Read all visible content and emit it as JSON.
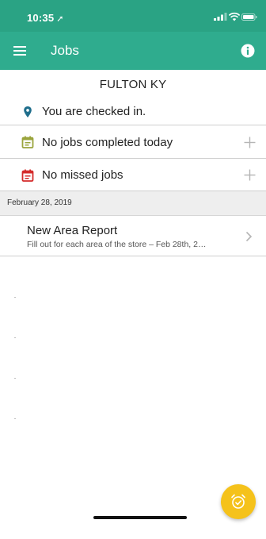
{
  "status_bar": {
    "time": "10:35",
    "location_glyph": "➚",
    "icons": [
      "signal-icon",
      "wifi-icon",
      "battery-icon"
    ]
  },
  "app_bar": {
    "title": "Jobs",
    "menu_icon": "hamburger-menu-icon",
    "info_icon": "info-icon"
  },
  "store_name": "FULTON KY",
  "status_rows": {
    "checkin": {
      "label": "You are checked in.",
      "icon": "location-pin-icon",
      "color": "#1f6e8c"
    },
    "completed": {
      "label": "No jobs completed today",
      "icon": "calendar-icon",
      "color": "#9aa43c"
    },
    "missed": {
      "label": "No missed jobs",
      "icon": "calendar-icon",
      "color": "#d42a2a"
    }
  },
  "jobs_section": {
    "date": "February 28, 2019",
    "jobs": [
      {
        "title": "New Area Report",
        "description": "Fill out for each area of the store – Feb 28th, 2…"
      }
    ]
  },
  "fab": {
    "icon": "alarm-clock-icon",
    "color": "#f5c21b"
  },
  "colors": {
    "status_bar": "#2aa384",
    "app_bar": "#2fac8e",
    "divider": "#cfcfcf",
    "section_header": "#eeeeee"
  }
}
